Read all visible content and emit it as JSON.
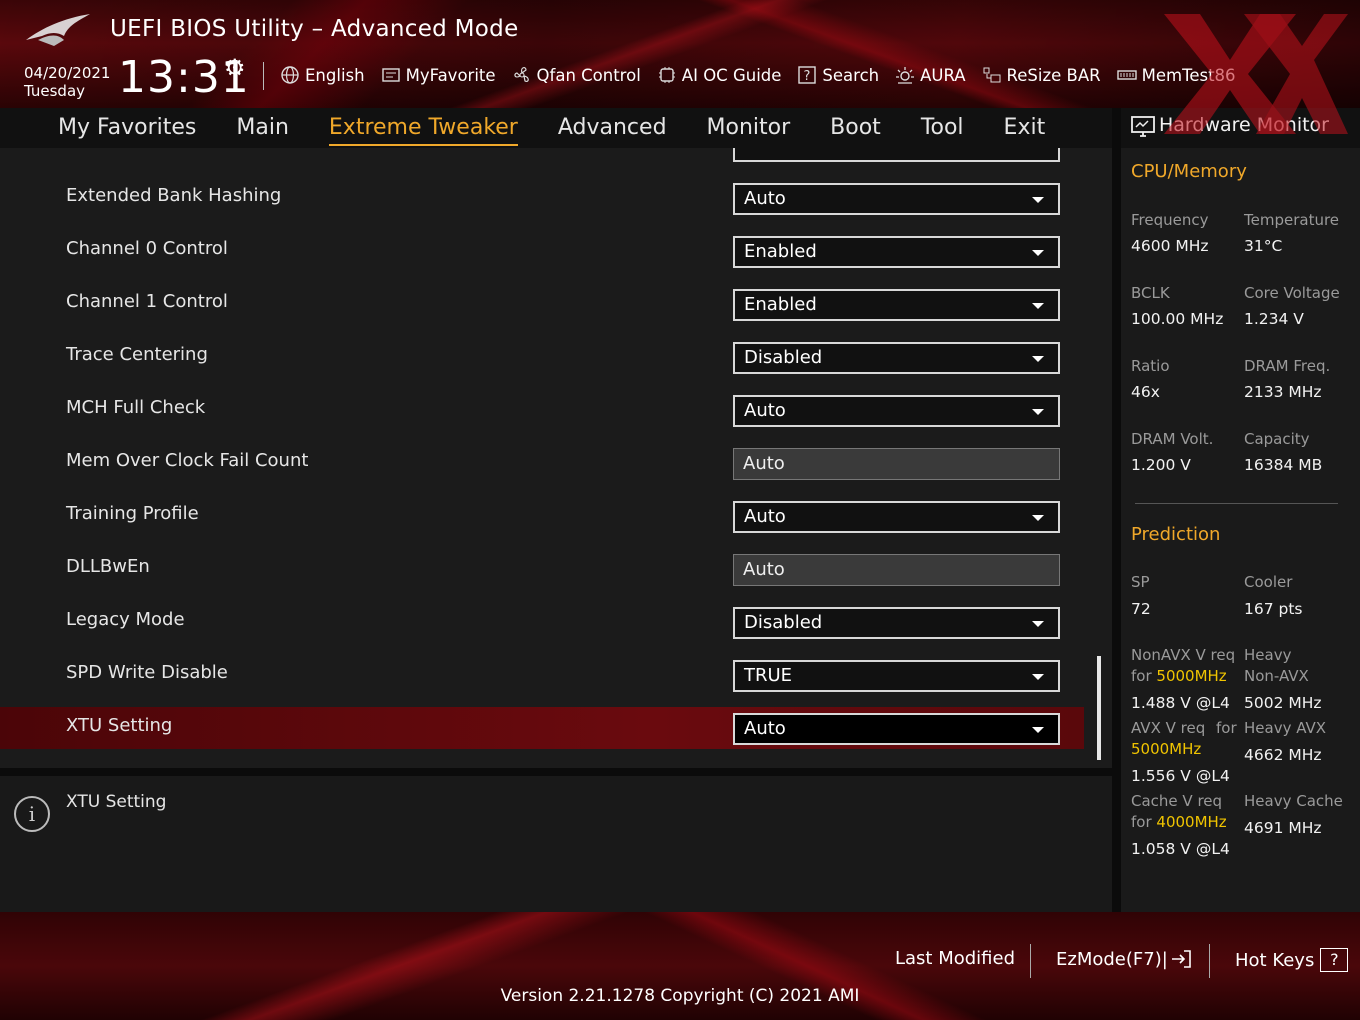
{
  "header": {
    "title": "UEFI BIOS Utility – Advanced Mode",
    "date": "04/20/2021",
    "day": "Tuesday",
    "time": "13:31",
    "toolbar": [
      {
        "label": "English",
        "icon": "globe-icon"
      },
      {
        "label": "MyFavorite",
        "icon": "favorite-icon"
      },
      {
        "label": "Qfan Control",
        "icon": "fan-icon"
      },
      {
        "label": "AI OC Guide",
        "icon": "ai-chip-icon"
      },
      {
        "label": "Search",
        "icon": "search-icon"
      },
      {
        "label": "AURA",
        "icon": "aura-light-icon"
      },
      {
        "label": "ReSize BAR",
        "icon": "resize-bar-icon"
      },
      {
        "label": "MemTest86",
        "icon": "memtest-icon"
      }
    ]
  },
  "tabs": [
    {
      "label": "My Favorites",
      "active": false
    },
    {
      "label": "Main",
      "active": false
    },
    {
      "label": "Extreme Tweaker",
      "active": true
    },
    {
      "label": "Advanced",
      "active": false
    },
    {
      "label": "Monitor",
      "active": false
    },
    {
      "label": "Boot",
      "active": false
    },
    {
      "label": "Tool",
      "active": false
    },
    {
      "label": "Exit",
      "active": false
    }
  ],
  "settings": [
    {
      "label": "Extended Bank Hashing",
      "value": "Auto",
      "readonly": false
    },
    {
      "label": "Channel 0 Control",
      "value": "Enabled",
      "readonly": false
    },
    {
      "label": "Channel 1 Control",
      "value": "Enabled",
      "readonly": false
    },
    {
      "label": "Trace Centering",
      "value": "Disabled",
      "readonly": false
    },
    {
      "label": "MCH Full Check",
      "value": "Auto",
      "readonly": false
    },
    {
      "label": "Mem Over Clock Fail Count",
      "value": "Auto",
      "readonly": true
    },
    {
      "label": "Training Profile",
      "value": "Auto",
      "readonly": false
    },
    {
      "label": "DLLBwEn",
      "value": "Auto",
      "readonly": true
    },
    {
      "label": "Legacy Mode",
      "value": "Disabled",
      "readonly": false
    },
    {
      "label": "SPD Write Disable",
      "value": "TRUE",
      "readonly": false
    },
    {
      "label": "XTU Setting",
      "value": "Auto",
      "readonly": false,
      "selected": true
    }
  ],
  "help": {
    "text": "XTU Setting"
  },
  "hw_monitor": {
    "title": "Hardware Monitor",
    "cpu_memory": {
      "heading": "CPU/Memory",
      "frequency_label": "Frequency",
      "frequency": "4600 MHz",
      "temperature_label": "Temperature",
      "temperature": "31°C",
      "bclk_label": "BCLK",
      "bclk": "100.00 MHz",
      "core_voltage_label": "Core Voltage",
      "core_voltage": "1.234 V",
      "ratio_label": "Ratio",
      "ratio": "46x",
      "dram_freq_label": "DRAM Freq.",
      "dram_freq": "2133 MHz",
      "dram_volt_label": "DRAM Volt.",
      "dram_volt": "1.200 V",
      "capacity_label": "Capacity",
      "capacity": "16384 MB"
    },
    "prediction": {
      "heading": "Prediction",
      "sp_label": "SP",
      "sp": "72",
      "cooler_label": "Cooler",
      "cooler": "167 pts",
      "nonavx_label": "NonAVX V req",
      "for_word": "for",
      "nonavx_freq": "5000MHz",
      "nonavx_v": "1.488 V @L4",
      "heavy_nonavx_label_1": "Heavy",
      "heavy_nonavx_label_2": "Non-AVX",
      "heavy_nonavx": "5002 MHz",
      "avx_label": "AVX V req",
      "avx_for": "for",
      "avx_freq": "5000MHz",
      "avx_v": "1.556 V @L4",
      "heavy_avx_label": "Heavy AVX",
      "heavy_avx": "4662 MHz",
      "cache_label": "Cache V req",
      "cache_freq": "4000MHz",
      "cache_v": "1.058 V @L4",
      "heavy_cache_label": "Heavy Cache",
      "heavy_cache": "4691 MHz"
    }
  },
  "footer": {
    "last_modified": "Last Modified",
    "ezmode": "EzMode(F7)|",
    "hotkeys": "Hot Keys",
    "hotkeys_icon_glyph": "?",
    "version": "Version 2.21.1278 Copyright (C) 2021 AMI"
  },
  "colors": {
    "accent": "#f0a82a",
    "brand_red": "#6a0a0e",
    "highlight_yellow": "#f0c400"
  }
}
